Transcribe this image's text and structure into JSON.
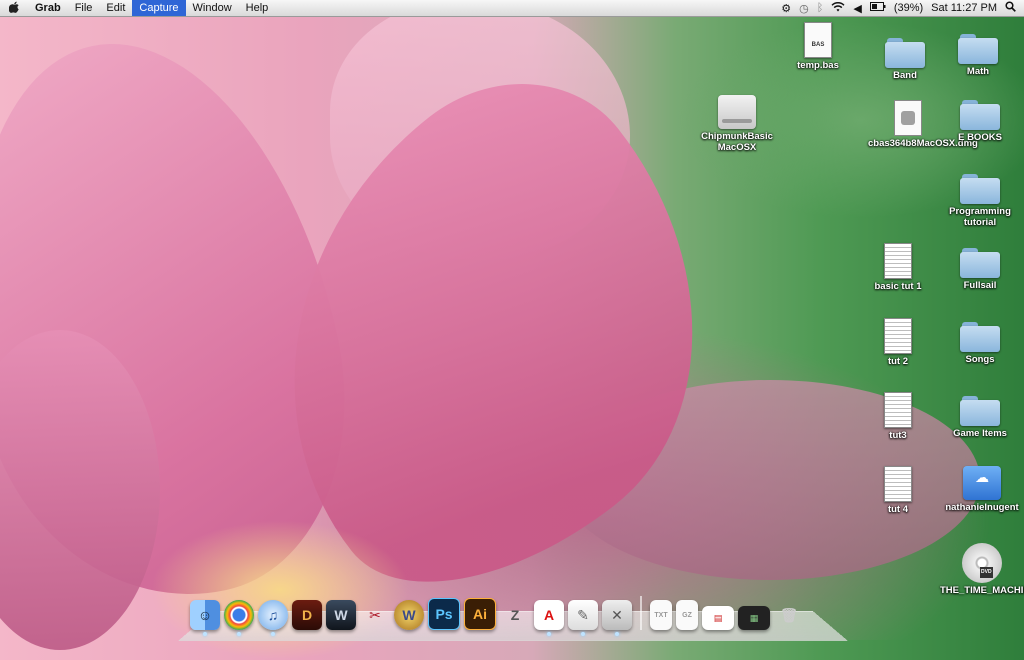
{
  "menubar": {
    "apple": "",
    "items": [
      "Grab",
      "File",
      "Edit",
      "Capture",
      "Window",
      "Help"
    ],
    "battery": "(39%)",
    "clock": "Sat 11:27 PM"
  },
  "desktop": {
    "temp_bas": "temp.bas",
    "temp_bas_tag": "BAS",
    "chipmunk": "ChipmunkBasic MacOSX",
    "band": "Band",
    "math": "Math",
    "cbas_dmg": "cbas364b8MacOSX.dmg",
    "ebooks": "E BOOKS",
    "programming": "Programming tutorial",
    "basic_tut1": "basic tut 1",
    "fullsail": "Fullsail",
    "tut2": "tut 2",
    "songs": "Songs",
    "tut3": "tut3",
    "game_items": "Game Items",
    "tut4": "tut 4",
    "nathanielnugent": "nathanielnugent",
    "time_machine": "THE_TIME_MACHINE",
    "dvd_tag": "DVD"
  },
  "dock": {
    "finder": "☺",
    "chrome": "◉",
    "itunes": "♫",
    "diablo": "D",
    "warcraft": "W",
    "tool": "✂",
    "wow": "W",
    "ps": "Ps",
    "ai": "Ai",
    "zbrush": "Z",
    "acrobat": "A",
    "preview": "✎",
    "utility": "✕",
    "trash": "🗑"
  }
}
